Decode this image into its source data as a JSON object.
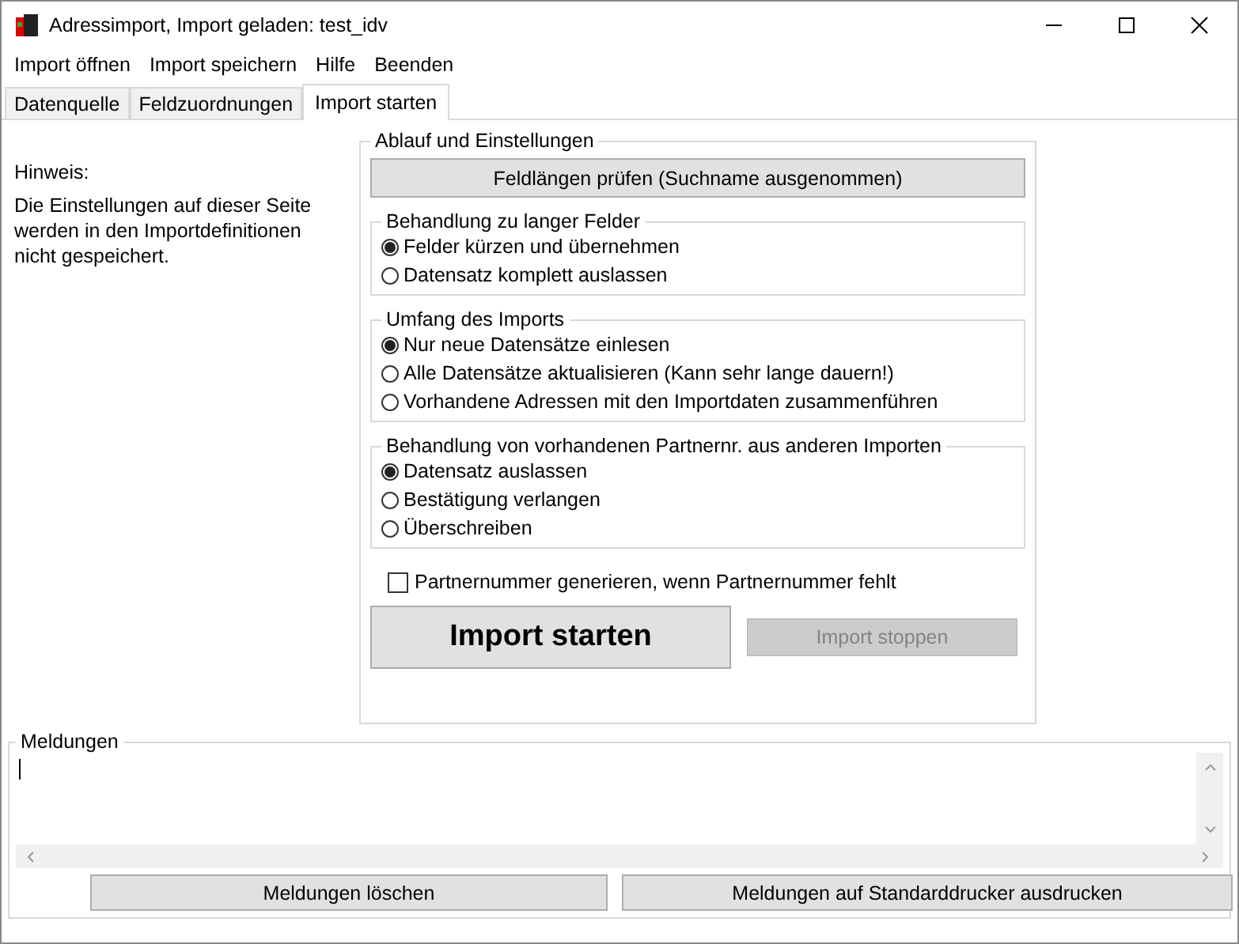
{
  "window": {
    "title": "Adressimport, Import geladen: test_idv"
  },
  "menu": [
    "Import öffnen",
    "Import speichern",
    "Hilfe",
    "Beenden"
  ],
  "tabs": [
    {
      "label": "Datenquelle",
      "selected": false
    },
    {
      "label": "Feldzuordnungen",
      "selected": false
    },
    {
      "label": "Import starten",
      "selected": true
    }
  ],
  "hint": {
    "title": "Hinweis:",
    "text": "Die Einstellungen auf dieser Seite werden in den Importdefinitionen nicht gespeichert."
  },
  "settings": {
    "title": "Ablauf und Einstellungen",
    "check_button": "Feldlängen prüfen (Suchname ausgenommen)",
    "groups": [
      {
        "title": "Behandlung zu langer Felder",
        "options": [
          {
            "label": "Felder kürzen und übernehmen",
            "selected": true
          },
          {
            "label": "Datensatz komplett auslassen",
            "selected": false
          }
        ]
      },
      {
        "title": "Umfang des Imports",
        "options": [
          {
            "label": "Nur neue Datensätze einlesen",
            "selected": true
          },
          {
            "label": "Alle Datensätze aktualisieren (Kann sehr lange dauern!)",
            "selected": false
          },
          {
            "label": "Vorhandene Adressen mit den Importdaten zusammenführen",
            "selected": false
          }
        ]
      },
      {
        "title": "Behandlung von vorhandenen Partnernr. aus anderen Importen",
        "options": [
          {
            "label": "Datensatz auslassen",
            "selected": true
          },
          {
            "label": "Bestätigung verlangen",
            "selected": false
          },
          {
            "label": "Überschreiben",
            "selected": false
          }
        ]
      }
    ],
    "checkbox": {
      "label": "Partnernummer generieren, wenn Partnernummer fehlt",
      "checked": false
    },
    "start_button": {
      "label": "Import starten",
      "disabled": false
    },
    "stop_button": {
      "label": "Import stoppen",
      "disabled": true
    }
  },
  "messages": {
    "title": "Meldungen",
    "buttons": [
      "Meldungen löschen",
      "Meldungen auf Standarddrucker ausdrucken"
    ]
  }
}
